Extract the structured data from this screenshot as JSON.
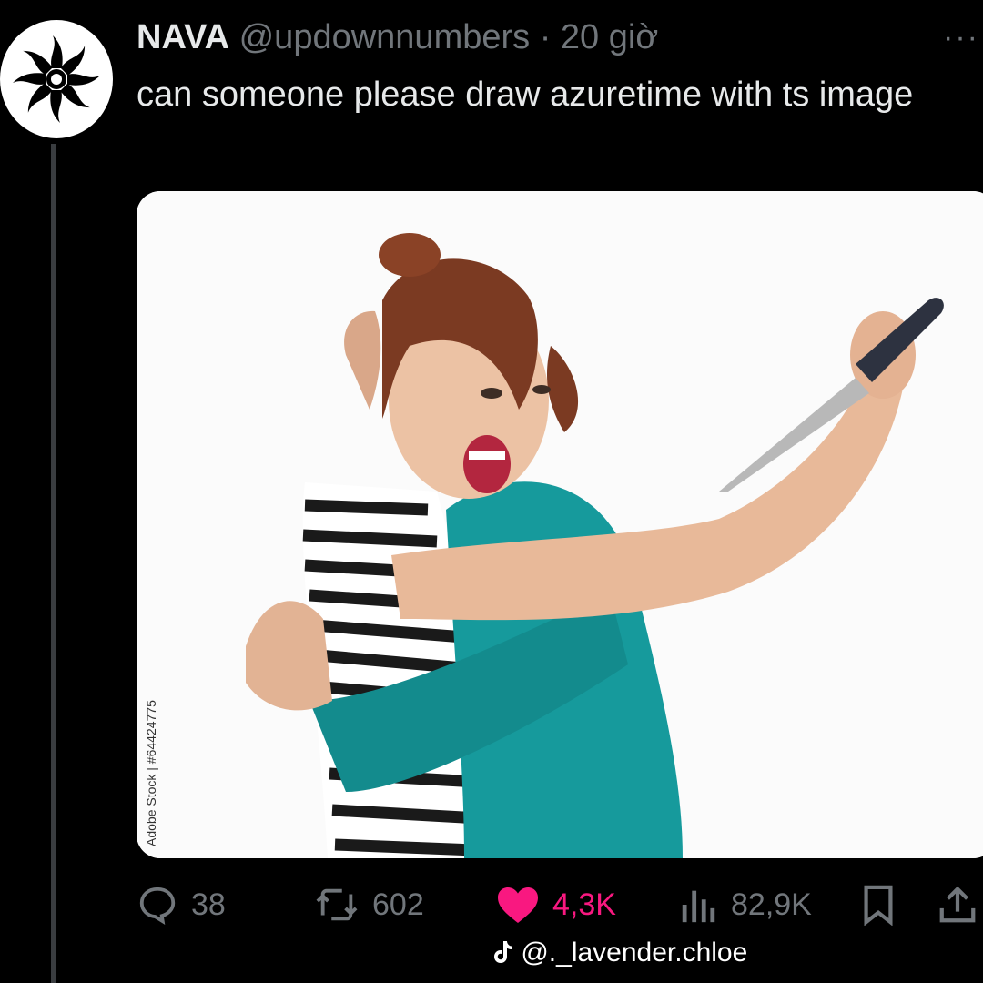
{
  "tweet": {
    "author_name": "NAVA",
    "handle": "@updownnumbers",
    "separator": "·",
    "time": "20 giờ",
    "more_label": "···",
    "text": "can someone please draw azuretime with ts image",
    "avatar_icon": "sun-emblem-icon",
    "media": {
      "watermark": "Adobe Stock | #64424775"
    }
  },
  "actions": {
    "replies": "38",
    "reposts": "602",
    "likes": "4,3K",
    "views": "82,9K"
  },
  "colors": {
    "background": "#000000",
    "text": "#e7e9ea",
    "muted": "#71767b",
    "like": "#f91880"
  },
  "overlay": {
    "tiktok_handle": "@._lavender.chloe"
  }
}
